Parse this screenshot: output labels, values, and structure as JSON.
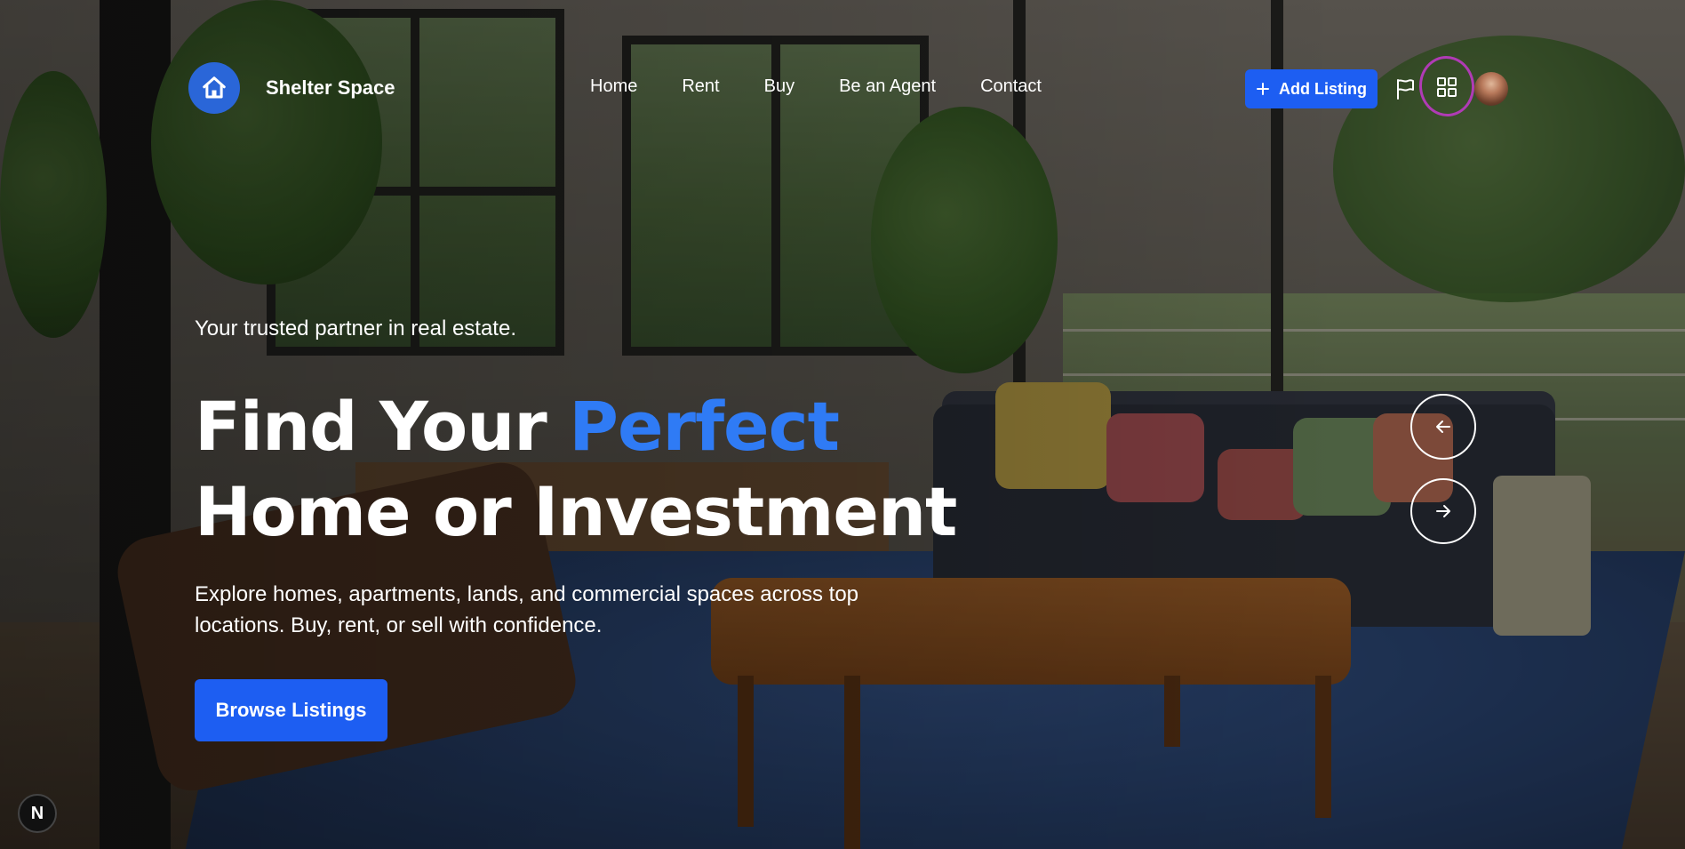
{
  "brand": {
    "name": "Shelter Space",
    "logo_icon": "house-icon",
    "accent_color": "#1d5ef2"
  },
  "nav": {
    "items": [
      {
        "label": "Home"
      },
      {
        "label": "Rent"
      },
      {
        "label": "Buy"
      },
      {
        "label": "Be an Agent"
      },
      {
        "label": "Contact"
      }
    ]
  },
  "actions": {
    "add_listing_label": "Add Listing",
    "add_listing_icon": "plus-icon",
    "flag_icon": "flag-icon",
    "dashboard_icon": "grid-icon",
    "avatar_icon": "avatar"
  },
  "hero": {
    "tagline": "Your trusted partner in real estate.",
    "headline_part1": "Find Your ",
    "headline_accent": "Perfect",
    "headline_part2": "Home or Investment",
    "accent_color": "#2f7bf5",
    "subtext": "Explore homes, apartments, lands, and commercial spaces across top locations. Buy, rent, or sell with confidence.",
    "cta_label": "Browse Listings"
  },
  "carousel": {
    "prev_icon": "arrow-left-icon",
    "next_icon": "arrow-right-icon"
  },
  "dev_badge": {
    "label": "N"
  }
}
